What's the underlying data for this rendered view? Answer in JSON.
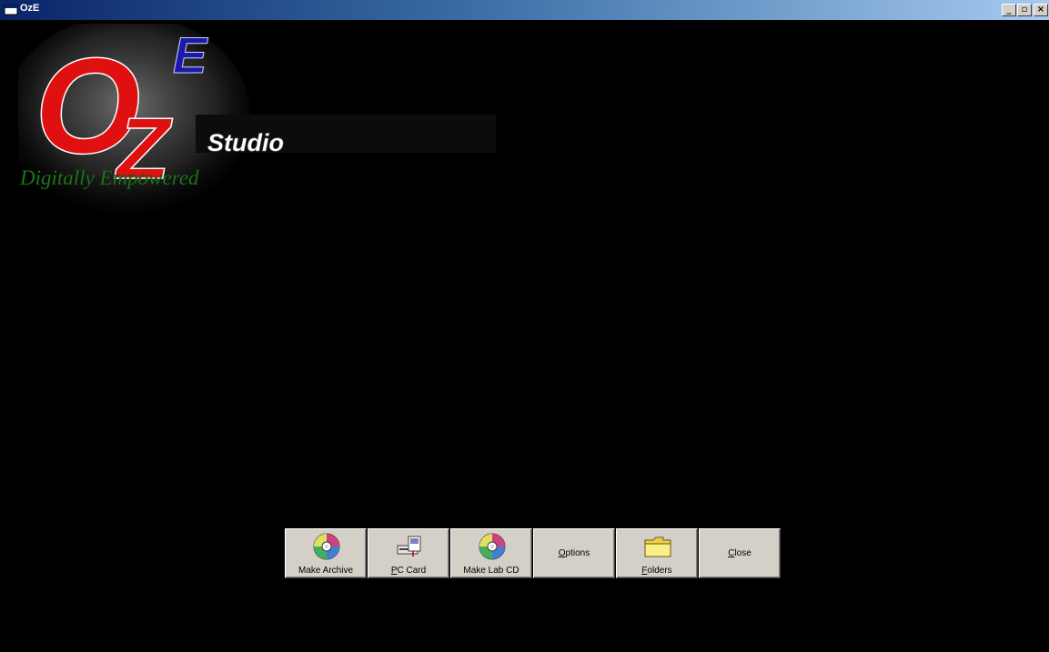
{
  "window": {
    "title": "OzE",
    "controls": {
      "minimize_glyph": "_",
      "maximize_glyph": "▫",
      "close_glyph": "×"
    }
  },
  "logo": {
    "letter_o": "O",
    "letter_z": "Z",
    "letter_e": "E",
    "studio": "Studio",
    "tagline": "Digitally Empowered",
    "colors": {
      "oz": "#e01010",
      "e": "#1a1aa8",
      "studio": "#ffffff",
      "tagline": "#1f7a1f"
    }
  },
  "toolbar": {
    "buttons": [
      {
        "id": "make-archive",
        "accel": "",
        "rest": "Make Archive",
        "icon": "cd-icon"
      },
      {
        "id": "pc-card",
        "accel": "P",
        "rest": "C Card",
        "icon": "pc-card-icon"
      },
      {
        "id": "make-lab-cd",
        "accel": "",
        "rest": "Make Lab CD",
        "icon": "cd-icon"
      },
      {
        "id": "options",
        "accel": "O",
        "rest": "ptions",
        "icon": ""
      },
      {
        "id": "folders",
        "accel": "F",
        "rest": "olders",
        "icon": "folder-icon"
      },
      {
        "id": "close",
        "accel": "C",
        "rest": "lose",
        "icon": ""
      }
    ]
  }
}
